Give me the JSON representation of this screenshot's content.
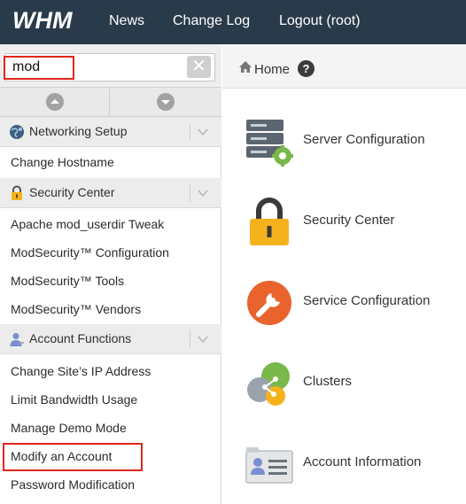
{
  "topbar": {
    "logo": "WHM",
    "nav": [
      "News",
      "Change Log",
      "Logout (root)"
    ]
  },
  "sidebar": {
    "search": {
      "value": "mod",
      "placeholder": ""
    },
    "sections": [
      {
        "title": "Networking Setup",
        "icon": "globe-icon",
        "items": [
          "Change Hostname"
        ]
      },
      {
        "title": "Security Center",
        "icon": "lock-icon",
        "items": [
          "Apache mod_userdir Tweak",
          "ModSecurity™ Configuration",
          "ModSecurity™ Tools",
          "ModSecurity™ Vendors"
        ]
      },
      {
        "title": "Account Functions",
        "icon": "user-icon",
        "items": [
          "Change Site’s IP Address",
          "Limit Bandwidth Usage",
          "Manage Demo Mode",
          "Modify an Account",
          "Password Modification"
        ]
      }
    ]
  },
  "main": {
    "breadcrumb": "Home",
    "features": [
      {
        "label": "Server Configuration",
        "icon": "server-gear-icon"
      },
      {
        "label": "Security Center",
        "icon": "padlock-icon"
      },
      {
        "label": "Service Configuration",
        "icon": "wrench-icon"
      },
      {
        "label": "Clusters",
        "icon": "share-icon"
      },
      {
        "label": "Account Information",
        "icon": "id-card-icon"
      }
    ]
  },
  "colors": {
    "topbar": "#293a4a",
    "highlight": "#e0261b",
    "lock_gold": "#f3b21c",
    "wrench_orange": "#e8642c",
    "cluster_green": "#79b84a"
  }
}
